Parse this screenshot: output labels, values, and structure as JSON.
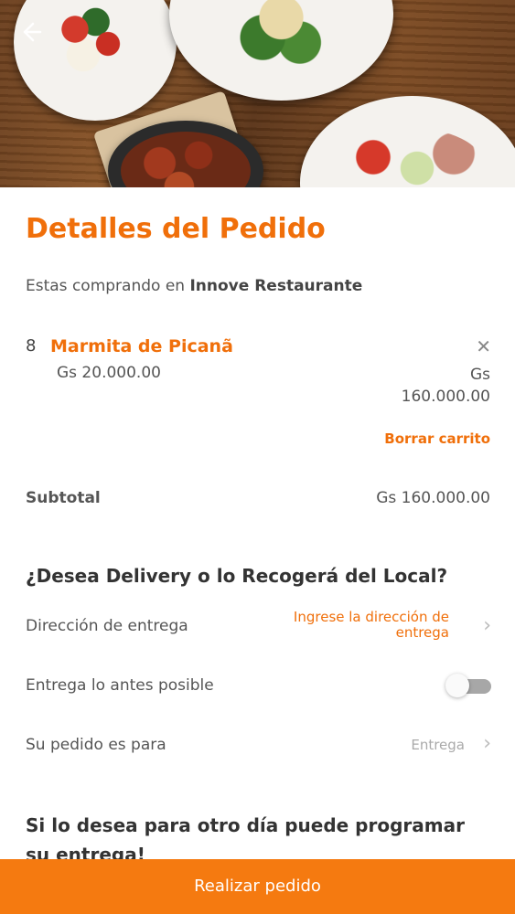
{
  "header": {
    "back_icon": "arrow-left-icon",
    "image_alt": "restaurant dishes"
  },
  "order": {
    "title": "Detalles del Pedido",
    "buying_prefix": "Estas comprando en",
    "restaurant_name": "Innove Restaurante",
    "item": {
      "qty": "8",
      "name": "Marmita de Picanã",
      "unit_price": "Gs 20.000.00",
      "total_currency": "Gs",
      "total_amount": "160.000.00",
      "remove_icon": "close-icon"
    },
    "clear_cart": "Borrar carrito",
    "subtotal_label": "Subtotal",
    "subtotal_value": "Gs 160.000.00"
  },
  "delivery": {
    "question": "¿Desea Delivery o lo Recogerá del Local?",
    "address_label": "Dirección de entrega",
    "address_placeholder": "Ingrese la dirección de entrega",
    "asap_label": "Entrega lo antes posible",
    "asap_enabled": false,
    "for_label": "Su pedido es para",
    "for_value": "Entrega",
    "schedule_text": "Si lo desea para otro día puede programar su entrega!"
  },
  "footer": {
    "submit_label": "Realizar pedido"
  },
  "colors": {
    "accent": "#f06f0a",
    "button": "#f57a10"
  }
}
